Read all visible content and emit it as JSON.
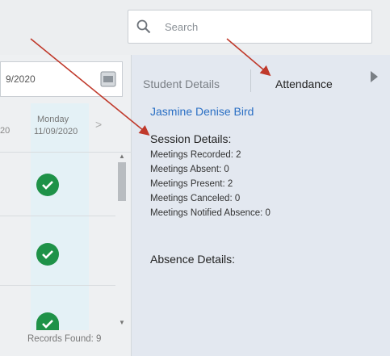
{
  "search": {
    "placeholder": "Search"
  },
  "date_filter": {
    "value": "9/2020"
  },
  "day_header": {
    "prev_fragment": "20",
    "day": "Monday",
    "date": "11/09/2020",
    "next_chevron": ">"
  },
  "footer": {
    "records_found": "Records Found: 9"
  },
  "tabs": [
    {
      "label": "Student Details",
      "active": false
    },
    {
      "label": "Attendance",
      "active": true
    }
  ],
  "student_name": "Jasmine Denise Bird",
  "session_details": {
    "heading": "Session Details:",
    "lines": [
      "Meetings Recorded: 2",
      "Meetings Absent: 0",
      "Meetings Present: 2",
      "Meetings Canceled: 0",
      "Meetings Notified Absence: 0"
    ]
  },
  "absence_details": {
    "heading": "Absence Details:"
  },
  "attendance_status": [
    "present",
    "present",
    "present"
  ],
  "colors": {
    "accent_link": "#2a6fc4",
    "present_green": "#1e9248",
    "annotation_arrow": "#c0392b"
  }
}
